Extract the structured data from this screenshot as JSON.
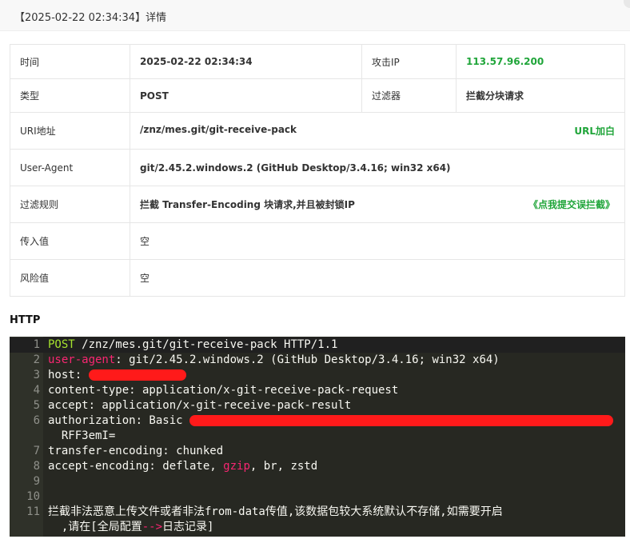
{
  "header": {
    "title": "【2025-02-22 02:34:34】详情"
  },
  "details": {
    "time_label": "时间",
    "time_value": "2025-02-22 02:34:34",
    "attack_ip_label": "攻击IP",
    "attack_ip_value": "113.57.96.200",
    "type_label": "类型",
    "type_value": "POST",
    "filter_label": "过滤器",
    "filter_value": "拦截分块请求",
    "uri_label": "URI地址",
    "uri_value": "/znz/mes.git/git-receive-pack",
    "uri_action": "URL加白",
    "ua_label": "User-Agent",
    "ua_value": "git/2.45.2.windows.2 (GitHub Desktop/3.4.16; win32 x64)",
    "rule_label": "过滤规则",
    "rule_value": "拦截 Transfer-Encoding 块请求,并且被封锁IP",
    "rule_action": "《点我提交误拦截》",
    "input_label": "传入值",
    "input_value": "空",
    "risk_label": "风险值",
    "risk_value": "空"
  },
  "http": {
    "heading": "HTTP",
    "lines": {
      "n1": "1",
      "n2": "2",
      "n3": "3",
      "n4": "4",
      "n5": "5",
      "n6": "6",
      "n7": "7",
      "n8": "8",
      "n9": "9",
      "n10": "10",
      "n11": "11",
      "l1_method": "POST",
      "l1_rest": " /znz/mes.git/git-receive-pack HTTP/1.1",
      "l2_key": "user-agent",
      "l2_rest": ": git/2.45.2.windows.2 (GitHub Desktop/3.4.16; win32 x64)",
      "l3": "host: ",
      "l4": "content-type: application/x-git-receive-pack-request",
      "l5": "accept: application/x-git-receive-pack-result",
      "l6": "authorization: Basic ",
      "l6_wrap": "  RFF3emI=",
      "l7": "transfer-encoding: chunked",
      "l8_a": "accept-encoding: deflate, ",
      "l8_gzip": "gzip",
      "l8_b": ", br, zstd",
      "l11_a": "拦截非法恶意上传文件或者非法from-data传值,该数据包较大系统默认不存储,如需要开启",
      "l11_b": "  ,请在[全局配置",
      "l11_arrow": "-->",
      "l11_c": "日志记录]"
    }
  },
  "colors": {
    "accent_green": "#20a53a",
    "redaction": "#ff1a1a",
    "code_bg": "#272822"
  }
}
